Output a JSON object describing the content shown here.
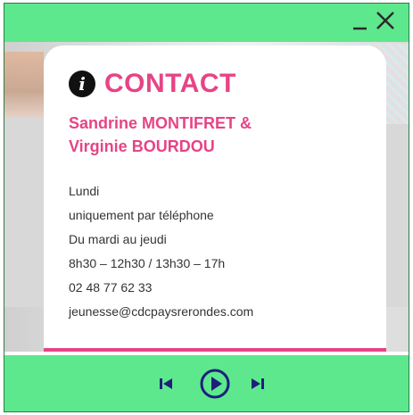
{
  "window": {
    "minimize_icon": "minimize-icon",
    "close_icon": "close-icon"
  },
  "contact": {
    "icon": "info-icon",
    "icon_glyph": "i",
    "title": "CONTACT",
    "name_line1": "Sandrine MONTIFRET &",
    "name_line2": "Virginie BOURDOU",
    "lines": [
      "Lundi",
      "uniquement par téléphone",
      "Du mardi au jeudi",
      "8h30 – 12h30 / 13h30 – 17h",
      "02 48 77 62 33",
      "jeunesse@cdcpaysrerondes.com"
    ]
  },
  "player": {
    "prev_icon": "previous-icon",
    "play_icon": "play-icon",
    "next_icon": "next-icon"
  },
  "colors": {
    "accent_green": "#5ee88d",
    "accent_pink": "#e64486",
    "control_navy": "#1d1f7a"
  }
}
